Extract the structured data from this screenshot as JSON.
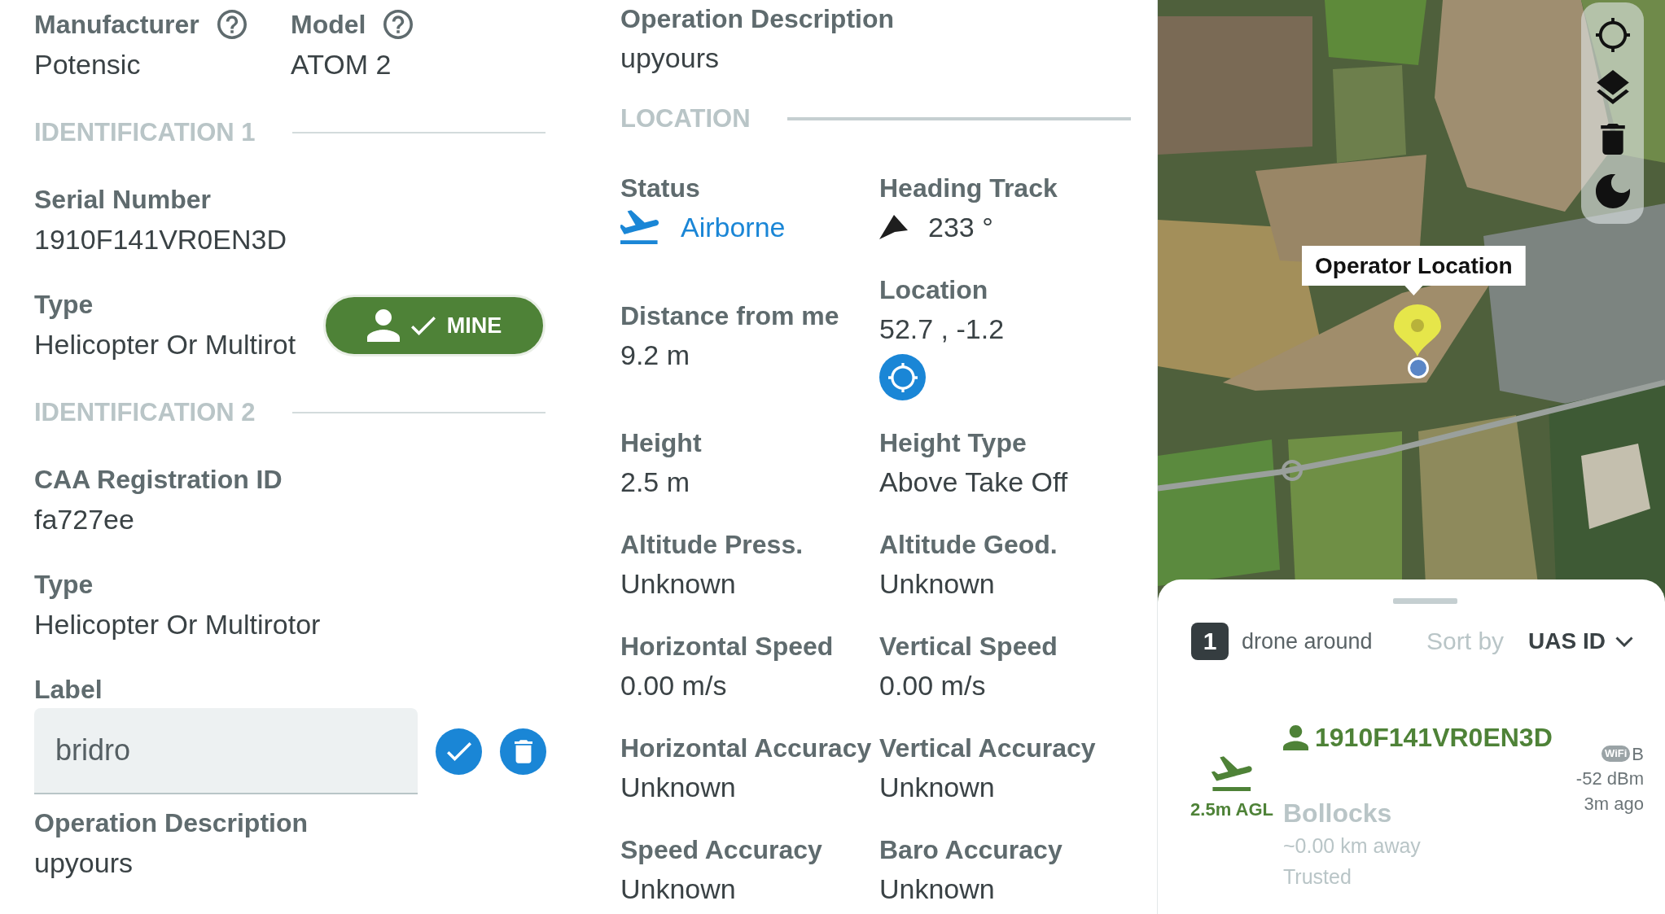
{
  "details": {
    "header_fields": [
      {
        "label": "Manufacturer",
        "value": "Potensic",
        "help": true
      },
      {
        "label": "Model",
        "value": "ATOM 2",
        "help": true
      }
    ],
    "sections": [
      {
        "title": "IDENTIFICATION 1",
        "fields": [
          {
            "label": "Serial Number",
            "value": "1910F141VR0EN3D"
          },
          {
            "label": "Type",
            "value": "Helicopter Or Multirot"
          }
        ],
        "mine_toggle": {
          "label": "MINE",
          "on": true
        }
      },
      {
        "title": "IDENTIFICATION 2",
        "fields": [
          {
            "label": "CAA Registration ID",
            "value": "fa727ee"
          },
          {
            "label": "Type",
            "value": "Helicopter Or Multirotor"
          }
        ]
      }
    ],
    "label_field": {
      "label": "Label",
      "value": "bridro"
    },
    "operation": {
      "label": "Operation Description",
      "value": "upyours"
    }
  },
  "location_panel": {
    "operation": {
      "label": "Operation Description",
      "value": "upyours"
    },
    "title": "LOCATION",
    "status": {
      "label": "Status",
      "value": "Airborne"
    },
    "heading": {
      "label": "Heading Track",
      "value": "233 °"
    },
    "distance": {
      "label": "Distance from me",
      "value": "9.2 m"
    },
    "location": {
      "label": "Location",
      "value": "52.7 , -1.2"
    },
    "fields": [
      {
        "label": "Height",
        "value": "2.5 m"
      },
      {
        "label": "Height Type",
        "value": "Above Take Off"
      },
      {
        "label": "Altitude Press.",
        "value": "Unknown"
      },
      {
        "label": "Altitude Geod.",
        "value": "Unknown"
      },
      {
        "label": "Horizontal Speed",
        "value": "0.00 m/s"
      },
      {
        "label": "Vertical Speed",
        "value": "0.00 m/s"
      },
      {
        "label": "Horizontal Accuracy",
        "value": "Unknown"
      },
      {
        "label": "Vertical Accuracy",
        "value": "Unknown"
      },
      {
        "label": "Speed Accuracy",
        "value": "Unknown"
      },
      {
        "label": "Baro Accuracy",
        "value": "Unknown"
      }
    ]
  },
  "map": {
    "marker_label": "Operator Location"
  },
  "drone_list": {
    "count": "1",
    "count_label": "drone around",
    "sort_label": "Sort by",
    "sort_value": "UAS ID",
    "items": [
      {
        "altitude": "2.5m AGL",
        "mine": true,
        "id": "1910F141VR0EN3D",
        "label": "Bollocks",
        "distance": "~0.00 km away",
        "trust": "Trusted",
        "transport_tag": "WiFi",
        "transport_suffix": "B",
        "rssi": "-52 dBm",
        "age": "3m ago"
      }
    ]
  }
}
